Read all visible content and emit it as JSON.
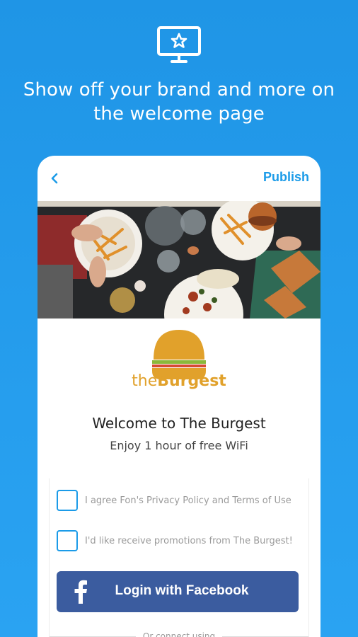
{
  "header": {
    "icon": "monitor-star-icon",
    "headline_line1": "Show off your brand and more on",
    "headline_line2": "the welcome page"
  },
  "phone": {
    "topbar": {
      "back_icon": "chevron-left-icon",
      "publish_label": "Publish"
    },
    "banner": {
      "description_icon": "restaurant-table-food-image"
    },
    "brand": {
      "logo_icon": "burger-logo-icon",
      "name_prefix": "the",
      "name_main": "Burgest"
    },
    "welcome_title": "Welcome to The Burgest",
    "wifi_subtitle": "Enjoy 1 hour of free WiFi",
    "form": {
      "agree_label": "I agree Fon's Privacy Policy and Terms of Use",
      "promo_label": "I'd like receive promotions from The Burgest!",
      "facebook_button_label": "Login with Facebook",
      "facebook_icon": "facebook-f-icon",
      "or_connect_label": "Or connect using"
    }
  },
  "colors": {
    "background_top": "#1f95e6",
    "background_bottom": "#2aa3f2",
    "accent_blue": "#1b9be8",
    "facebook_blue": "#3b5c9f",
    "brand_orange": "#e1a12b"
  }
}
